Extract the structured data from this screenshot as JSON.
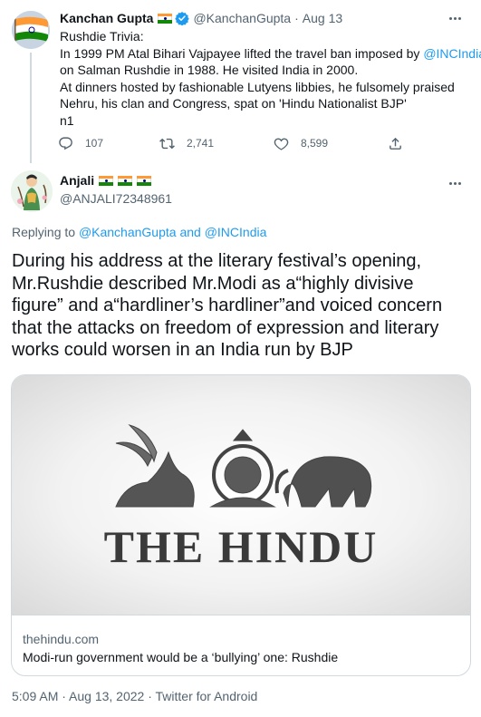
{
  "parent_tweet": {
    "author_name": "Kanchan Gupta",
    "handle": "@KanchanGupta",
    "separator": "·",
    "date": "Aug 13",
    "body_lines": [
      "Rushdie Trivia:",
      "In 1999 PM Atal Bihari Vajpayee lifted the travel ban imposed by ",
      "on Salman Rushdie in 1988. He visited India in 2000.",
      "At dinners hosted by fashionable Lutyens libbies, he fulsomely praised",
      "Nehru, his clan and Congress, spat on 'Hindu Nationalist BJP'",
      "n1"
    ],
    "mention": "@INCIndia",
    "replies": "107",
    "retweets": "2,741",
    "likes": "8,599"
  },
  "main_tweet": {
    "author_name": "Anjali",
    "handle": "@ANJALI72348961",
    "replying_prefix": "Replying to ",
    "replying_to": "@KanchanGupta and @INCIndia",
    "text_lines": [
      "During his address at the literary festival’s opening,",
      "Mr.Rushdie described Mr.Modi as a“highly divisive",
      "figure” and a“hardliner’s hardliner”and voiced concern",
      "that the attacks on freedom of expression and literary",
      "works could worsen in an India run by BJP"
    ],
    "card": {
      "image_text": "THE HINDU",
      "domain": "thehindu.com",
      "title": "Modi-run government would be a ‘bullying’ one: Rushdie"
    },
    "timestamp": "5:09 AM · Aug 13, 2022 · Twitter for Android"
  },
  "colors": {
    "link": "#1d9bf0",
    "secondary_text": "#536471",
    "divider": "#cfd9de",
    "saffron": "#ff9933",
    "india_green": "#138808"
  },
  "icons": [
    "verified-icon",
    "more-icon",
    "reply-icon",
    "retweet-icon",
    "like-icon",
    "share-icon",
    "india-flag-icon"
  ]
}
